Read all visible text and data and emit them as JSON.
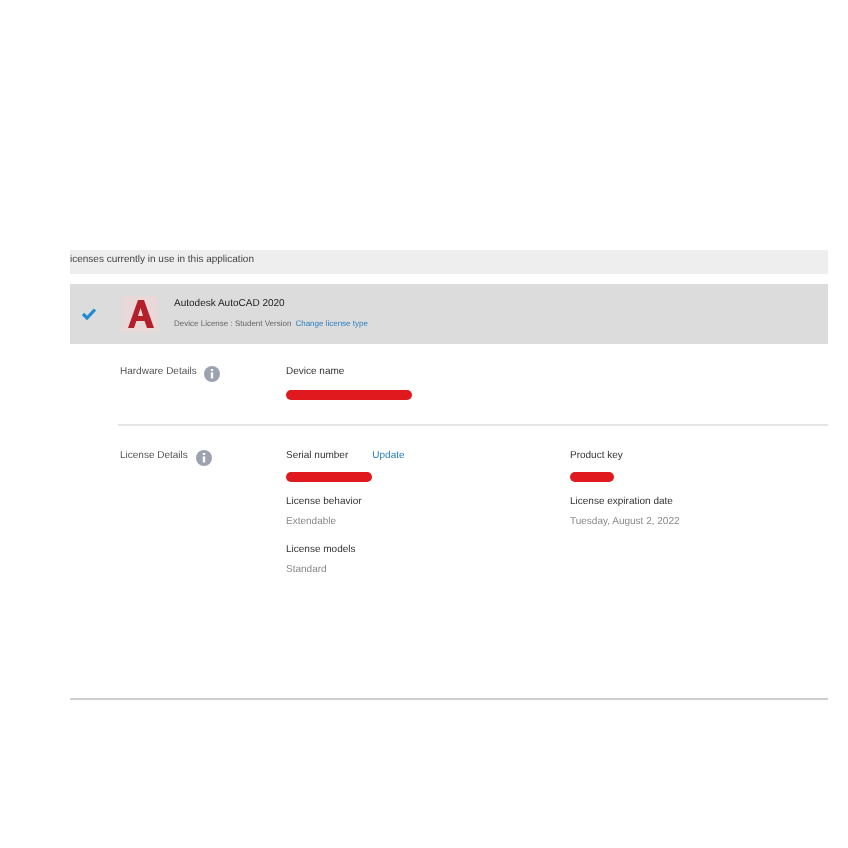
{
  "section_header": "icenses currently in use in this application",
  "product": {
    "checked": true,
    "name": "Autodesk AutoCAD 2020",
    "license": "Device License : Student Version",
    "change_link": "Change license type"
  },
  "hardware": {
    "label": "Hardware Details",
    "fields": [
      {
        "label": "Device name",
        "redacted": true
      }
    ]
  },
  "license": {
    "label": "License Details",
    "update_link": "Update",
    "fields": [
      {
        "label": "Serial number",
        "redacted": true
      },
      {
        "label": "Product key",
        "redacted": true
      },
      {
        "label": "License behavior",
        "value": "Extendable"
      },
      {
        "label": "License expiration date",
        "value": "Tuesday, August 2, 2022"
      },
      {
        "label": "License models",
        "value": "Standard"
      }
    ]
  }
}
